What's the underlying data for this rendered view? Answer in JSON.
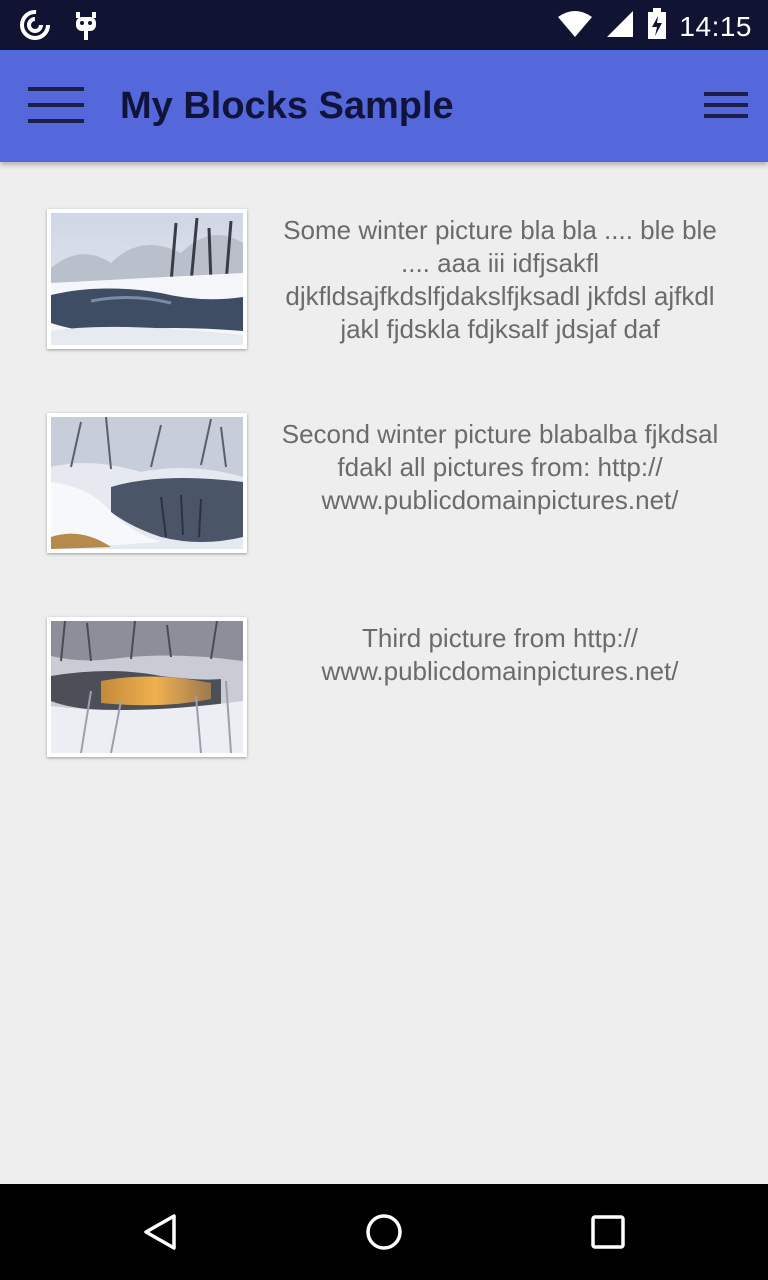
{
  "status_bar": {
    "time": "14:15",
    "icons": [
      "location-sync-icon",
      "android-debug-icon",
      "wifi-icon",
      "cell-signal-icon",
      "battery-icon"
    ]
  },
  "app_bar": {
    "title": "My Blocks Sample",
    "background_color": "#5468db",
    "left_icon": "hamburger-menu-icon",
    "right_icon": "overflow-menu-icon"
  },
  "items": [
    {
      "text": "Some winter picture bla bla .... ble ble .... aaa iii idfjsakfl djkfldsajfkdslfjdakslfjksadl jkfdsl ajfkdl jakl fjdskla fdjksalf jdsjaf daf"
    },
    {
      "text": "Second winter picture blabalba fjkdsal fdakl all pictures from: http:// www.publicdomainpictures.net/"
    },
    {
      "text": "Third picture from http:// www.publicdomainpictures.net/"
    }
  ],
  "nav_bar": {
    "buttons": [
      "back-icon",
      "home-icon",
      "recents-icon"
    ]
  }
}
